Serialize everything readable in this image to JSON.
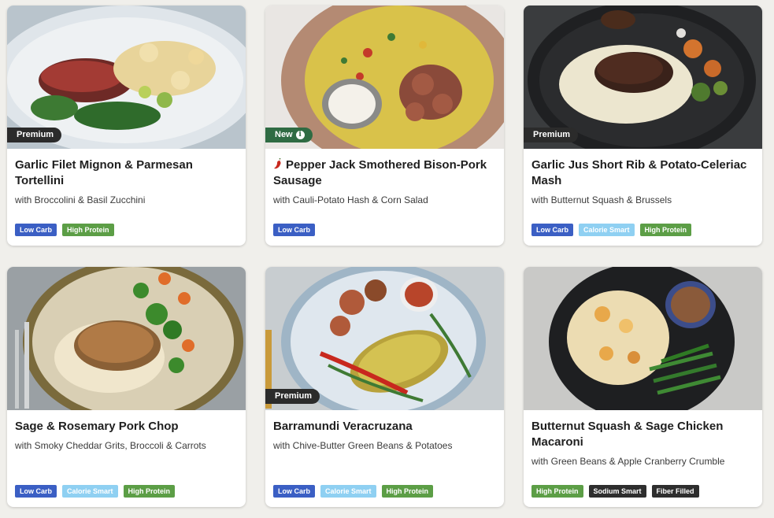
{
  "colors": {
    "low_carb": "#3b5fc4",
    "calorie_smart": "#8fd0f2",
    "high_protein": "#5c9e46",
    "dark_tag": "#2e2e2e",
    "premium_badge": "#2b2b2b",
    "new_badge": "#2f6b43"
  },
  "cards": [
    {
      "title": "Garlic Filet Mignon & Parmesan Tortellini",
      "subtitle": "with Broccolini & Basil Zucchini",
      "badge": "Premium",
      "tags": [
        "Low Carb",
        "High Protein"
      ]
    },
    {
      "title": "Pepper Jack Smothered Bison-Pork Sausage",
      "subtitle": "with Cauli-Potato Hash & Corn Salad",
      "badge": "New",
      "badge_icon": "info-icon",
      "title_icon": "chili-pepper-icon",
      "tags": [
        "Low Carb"
      ]
    },
    {
      "title": "Garlic Jus Short Rib & Potato-Celeriac Mash",
      "subtitle": "with Butternut Squash & Brussels",
      "badge": "Premium",
      "tags": [
        "Low Carb",
        "Calorie Smart",
        "High Protein"
      ]
    },
    {
      "title": "Sage & Rosemary Pork Chop",
      "subtitle": "with Smoky Cheddar Grits, Broccoli & Carrots",
      "tags": [
        "Low Carb",
        "Calorie Smart",
        "High Protein"
      ]
    },
    {
      "title": "Barramundi Veracruzana",
      "subtitle": "with Chive-Butter Green Beans & Potatoes",
      "badge": "Premium",
      "tags": [
        "Low Carb",
        "Calorie Smart",
        "High Protein"
      ]
    },
    {
      "title": "Butternut Squash & Sage Chicken Macaroni",
      "subtitle": "with Green Beans & Apple Cranberry Crumble",
      "tags": [
        "High Protein",
        "Sodium Smart",
        "Fiber Filled"
      ]
    }
  ]
}
